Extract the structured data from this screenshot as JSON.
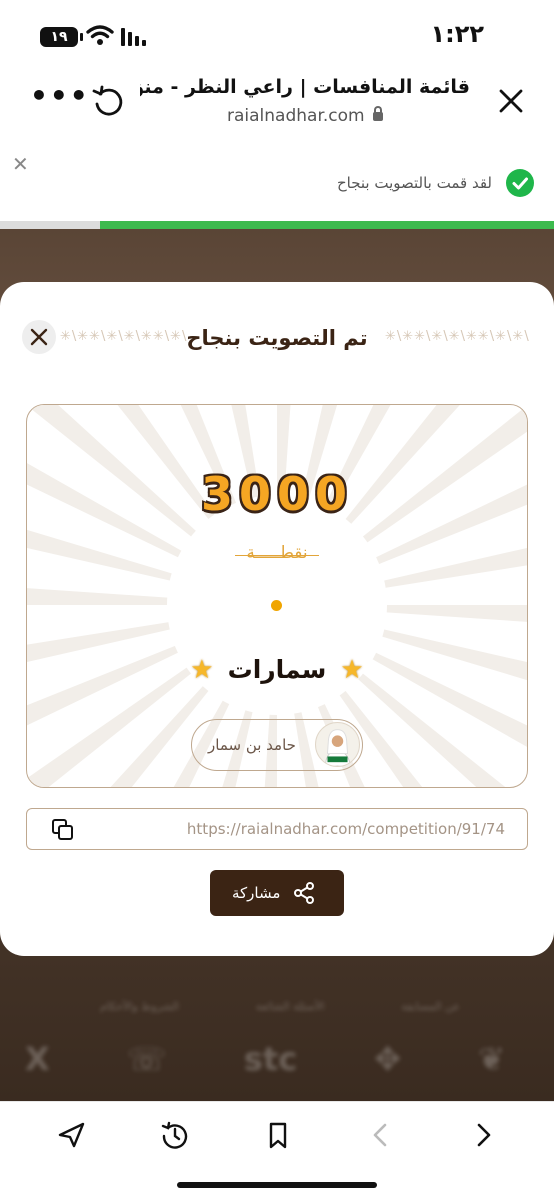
{
  "status_bar": {
    "time": "١:٢٢",
    "battery": "١٩"
  },
  "browser": {
    "title": "قائمة المنافسات | راعي النظر - منق...",
    "url": "raialnadhar.com"
  },
  "notification": {
    "text": "لقد قمت بالتصويت بنجاح",
    "progress": 0.82
  },
  "modal": {
    "title": "تم التصويت بنجاح",
    "ornament": "✳\\✳✳\\✳\\✳\\✳✳\\✳\\✳\\",
    "points": "3000",
    "points_label": "نقطـــــة",
    "contestant": "سمارات",
    "owner": "حامد بن سمار",
    "link": "https://raialnadhar.com/competition/91/74",
    "share_label": "مشاركة"
  },
  "background": {
    "links": [
      "عن المسابقة",
      "الأسئلة الشائعة",
      "الشروط والأحكام"
    ],
    "logos": [
      "X",
      "☏",
      "stc",
      "✥",
      "❦"
    ]
  },
  "colors": {
    "accent": "#3b2414",
    "points": "#f5a623",
    "success": "#1fb64a"
  },
  "icons": [
    "battery-icon",
    "wifi-icon",
    "signal-icon",
    "more-icon",
    "reload-icon",
    "close-tab-icon",
    "check-circle-icon",
    "close-icon",
    "star-icon",
    "copy-icon",
    "share-icon",
    "send-icon",
    "history-icon",
    "bookmark-icon",
    "back-icon",
    "forward-icon"
  ]
}
